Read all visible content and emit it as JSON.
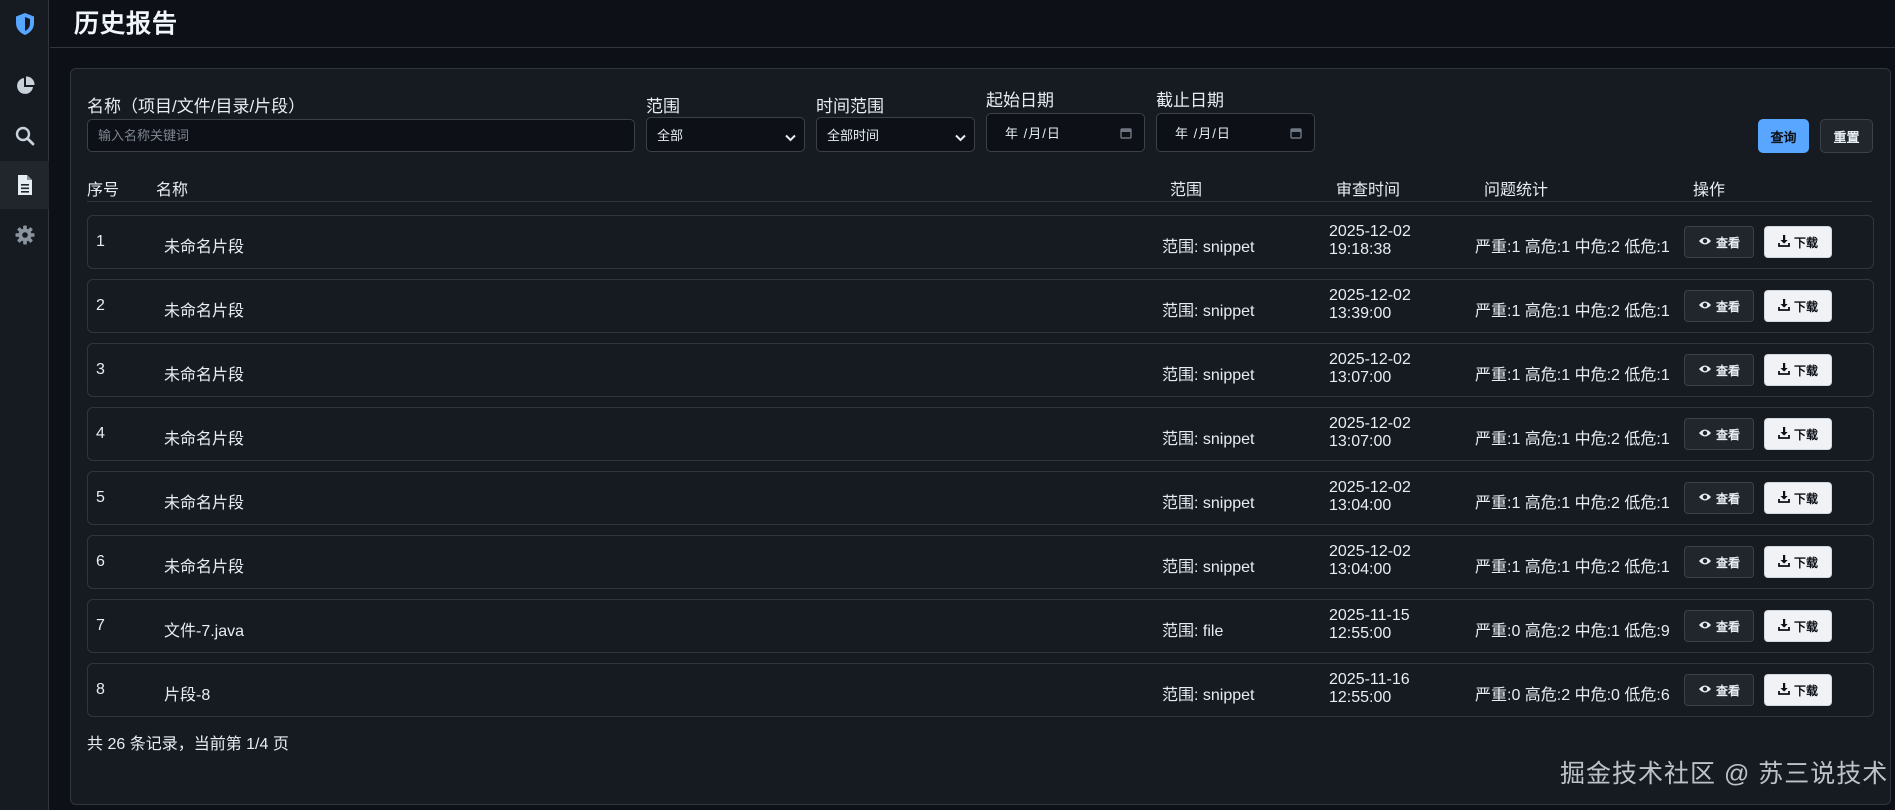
{
  "page": {
    "title": "历史报告"
  },
  "sidebar": {
    "items": [
      {
        "icon": "shield-logo-icon"
      },
      {
        "icon": "pie-chart-icon"
      },
      {
        "icon": "search-icon"
      },
      {
        "icon": "document-icon",
        "active": true
      },
      {
        "icon": "gear-icon"
      }
    ]
  },
  "filters": {
    "name_label": "名称（项目/文件/目录/片段）",
    "name_placeholder": "输入名称关键词",
    "scope_label": "范围",
    "scope_value": "全部",
    "time_label": "时间范围",
    "time_value": "全部时间",
    "start_label": "起始日期",
    "start_value": "年 /月/日",
    "end_label": "截止日期",
    "end_value": "年 /月/日",
    "query_button": "查询",
    "reset_button": "重置"
  },
  "table": {
    "headers": [
      "序号",
      "名称",
      "范围",
      "审查时间",
      "问题统计",
      "操作"
    ],
    "view_label": "查看",
    "download_label": "下载",
    "rows": [
      {
        "index": "1",
        "name": "未命名片段",
        "scope": "范围: snippet",
        "date": "2025-12-02",
        "time": "19:18:38",
        "stats": "严重:1 高危:1 中危:2 低危:1"
      },
      {
        "index": "2",
        "name": "未命名片段",
        "scope": "范围: snippet",
        "date": "2025-12-02",
        "time": "13:39:00",
        "stats": "严重:1 高危:1 中危:2 低危:1"
      },
      {
        "index": "3",
        "name": "未命名片段",
        "scope": "范围: snippet",
        "date": "2025-12-02",
        "time": "13:07:00",
        "stats": "严重:1 高危:1 中危:2 低危:1"
      },
      {
        "index": "4",
        "name": "未命名片段",
        "scope": "范围: snippet",
        "date": "2025-12-02",
        "time": "13:07:00",
        "stats": "严重:1 高危:1 中危:2 低危:1"
      },
      {
        "index": "5",
        "name": "未命名片段",
        "scope": "范围: snippet",
        "date": "2025-12-02",
        "time": "13:04:00",
        "stats": "严重:1 高危:1 中危:2 低危:1"
      },
      {
        "index": "6",
        "name": "未命名片段",
        "scope": "范围: snippet",
        "date": "2025-12-02",
        "time": "13:04:00",
        "stats": "严重:1 高危:1 中危:2 低危:1"
      },
      {
        "index": "7",
        "name": "文件-7.java",
        "scope": "范围: file",
        "date": "2025-11-15",
        "time": "12:55:00",
        "stats": "严重:0 高危:2 中危:1 低危:9"
      },
      {
        "index": "8",
        "name": "片段-8",
        "scope": "范围: snippet",
        "date": "2025-11-16",
        "time": "12:55:00",
        "stats": "严重:0 高危:2 中危:0 低危:6"
      }
    ]
  },
  "pagination": {
    "summary": "共 26 条记录，当前第 1/4 页"
  },
  "watermark": "掘金技术社区 @ 苏三说技术",
  "colors": {
    "accent": "#58a6ff",
    "background": "#0d1117",
    "panel": "#161b22"
  }
}
